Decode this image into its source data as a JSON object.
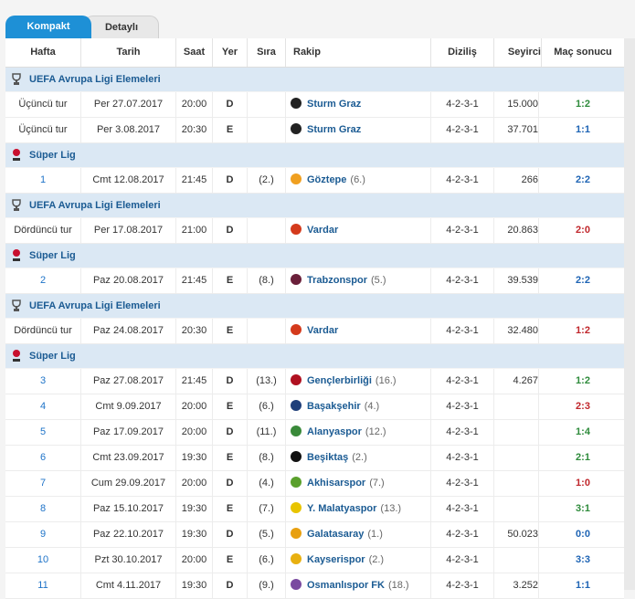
{
  "tabs": {
    "active": "Kompakt",
    "inactive": "Detaylı"
  },
  "columns": [
    "Hafta",
    "Tarih",
    "Saat",
    "Yer",
    "Sıra",
    "Rakip",
    "Diziliş",
    "Seyirci",
    "Maç sonucu"
  ],
  "rows": [
    {
      "type": "comp",
      "name": "UEFA Avrupa Ligi Elemeleri",
      "icon": "uefa-icon"
    },
    {
      "type": "match",
      "week": "Üçüncü tur",
      "week_link": false,
      "date": "Per 27.07.2017",
      "time": "20:00",
      "venue": "D",
      "rank": "",
      "team": "Sturm Graz",
      "team_rank": "",
      "badge": "#222222",
      "formation": "4-2-3-1",
      "attendance": "15.000",
      "result": "1:2",
      "res": "w"
    },
    {
      "type": "match",
      "week": "Üçüncü tur",
      "week_link": false,
      "date": "Per 3.08.2017",
      "time": "20:30",
      "venue": "E",
      "rank": "",
      "team": "Sturm Graz",
      "team_rank": "",
      "badge": "#222222",
      "formation": "4-2-3-1",
      "attendance": "37.701",
      "result": "1:1",
      "res": "d"
    },
    {
      "type": "comp",
      "name": "Süper Lig",
      "icon": "super-lig-icon"
    },
    {
      "type": "match",
      "week": "1",
      "week_link": true,
      "date": "Cmt 12.08.2017",
      "time": "21:45",
      "venue": "D",
      "rank": "(2.)",
      "team": "Göztepe",
      "team_rank": "(6.)",
      "badge": "#f0a020",
      "formation": "4-2-3-1",
      "attendance": "266",
      "result": "2:2",
      "res": "d"
    },
    {
      "type": "comp",
      "name": "UEFA Avrupa Ligi Elemeleri",
      "icon": "uefa-icon"
    },
    {
      "type": "match",
      "week": "Dördüncü tur",
      "week_link": false,
      "date": "Per 17.08.2017",
      "time": "21:00",
      "venue": "D",
      "rank": "",
      "team": "Vardar",
      "team_rank": "",
      "badge": "#d43a1c",
      "formation": "4-2-3-1",
      "attendance": "20.863",
      "result": "2:0",
      "res": "l"
    },
    {
      "type": "comp",
      "name": "Süper Lig",
      "icon": "super-lig-icon"
    },
    {
      "type": "match",
      "week": "2",
      "week_link": true,
      "date": "Paz 20.08.2017",
      "time": "21:45",
      "venue": "E",
      "rank": "(8.)",
      "team": "Trabzonspor",
      "team_rank": "(5.)",
      "badge": "#6a1f3a",
      "formation": "4-2-3-1",
      "attendance": "39.539",
      "result": "2:2",
      "res": "d"
    },
    {
      "type": "comp",
      "name": "UEFA Avrupa Ligi Elemeleri",
      "icon": "uefa-icon"
    },
    {
      "type": "match",
      "week": "Dördüncü tur",
      "week_link": false,
      "date": "Paz 24.08.2017",
      "time": "20:30",
      "venue": "E",
      "rank": "",
      "team": "Vardar",
      "team_rank": "",
      "badge": "#d43a1c",
      "formation": "4-2-3-1",
      "attendance": "32.480",
      "result": "1:2",
      "res": "l"
    },
    {
      "type": "comp",
      "name": "Süper Lig",
      "icon": "super-lig-icon"
    },
    {
      "type": "match",
      "week": "3",
      "week_link": true,
      "date": "Paz 27.08.2017",
      "time": "21:45",
      "venue": "D",
      "rank": "(13.)",
      "team": "Gençlerbirliği",
      "team_rank": "(16.)",
      "badge": "#b01020",
      "formation": "4-2-3-1",
      "attendance": "4.267",
      "result": "1:2",
      "res": "w"
    },
    {
      "type": "match",
      "week": "4",
      "week_link": true,
      "date": "Cmt 9.09.2017",
      "time": "20:00",
      "venue": "E",
      "rank": "(6.)",
      "team": "Başakşehir",
      "team_rank": "(4.)",
      "badge": "#1f3f7a",
      "formation": "4-2-3-1",
      "attendance": "",
      "result": "2:3",
      "res": "l"
    },
    {
      "type": "match",
      "week": "5",
      "week_link": true,
      "date": "Paz 17.09.2017",
      "time": "20:00",
      "venue": "D",
      "rank": "(11.)",
      "team": "Alanyaspor",
      "team_rank": "(12.)",
      "badge": "#3a8a3a",
      "formation": "4-2-3-1",
      "attendance": "",
      "result": "1:4",
      "res": "w"
    },
    {
      "type": "match",
      "week": "6",
      "week_link": true,
      "date": "Cmt 23.09.2017",
      "time": "19:30",
      "venue": "E",
      "rank": "(8.)",
      "team": "Beşiktaş",
      "team_rank": "(2.)",
      "badge": "#111111",
      "formation": "4-2-3-1",
      "attendance": "",
      "result": "2:1",
      "res": "w"
    },
    {
      "type": "match",
      "week": "7",
      "week_link": true,
      "date": "Cum 29.09.2017",
      "time": "20:00",
      "venue": "D",
      "rank": "(4.)",
      "team": "Akhisarspor",
      "team_rank": "(7.)",
      "badge": "#5aa02c",
      "formation": "4-2-3-1",
      "attendance": "",
      "result": "1:0",
      "res": "l"
    },
    {
      "type": "match",
      "week": "8",
      "week_link": true,
      "date": "Paz 15.10.2017",
      "time": "19:30",
      "venue": "E",
      "rank": "(7.)",
      "team": "Y. Malatyaspor",
      "team_rank": "(13.)",
      "badge": "#e8c400",
      "formation": "4-2-3-1",
      "attendance": "",
      "result": "3:1",
      "res": "w"
    },
    {
      "type": "match",
      "week": "9",
      "week_link": true,
      "date": "Paz 22.10.2017",
      "time": "19:30",
      "venue": "D",
      "rank": "(5.)",
      "team": "Galatasaray",
      "team_rank": "(1.)",
      "badge": "#e8a010",
      "formation": "4-2-3-1",
      "attendance": "50.023",
      "result": "0:0",
      "res": "d"
    },
    {
      "type": "match",
      "week": "10",
      "week_link": true,
      "date": "Pzt 30.10.2017",
      "time": "20:00",
      "venue": "E",
      "rank": "(6.)",
      "team": "Kayserispor",
      "team_rank": "(2.)",
      "badge": "#e8b010",
      "formation": "4-2-3-1",
      "attendance": "",
      "result": "3:3",
      "res": "d"
    },
    {
      "type": "match",
      "week": "11",
      "week_link": true,
      "date": "Cmt 4.11.2017",
      "time": "19:30",
      "venue": "D",
      "rank": "(9.)",
      "team": "Osmanlıspor FK",
      "team_rank": "(18.)",
      "badge": "#7a4aa0",
      "formation": "4-2-3-1",
      "attendance": "3.252",
      "result": "1:1",
      "res": "d"
    }
  ]
}
